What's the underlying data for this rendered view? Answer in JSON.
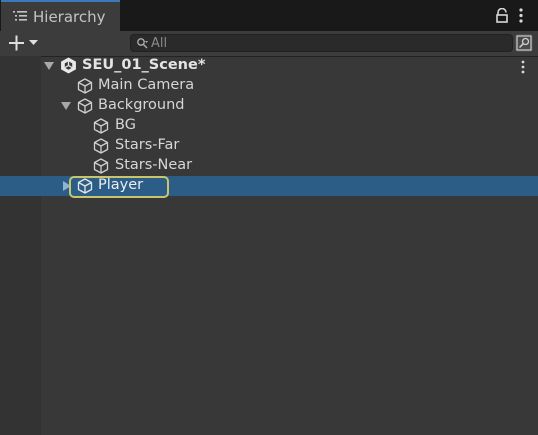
{
  "window": {
    "tab_title": "Hierarchy",
    "tab_icon": "list-icon"
  },
  "toolbar": {
    "add_label": "+",
    "search_placeholder": "All",
    "search_value": ""
  },
  "tree": {
    "scene": {
      "label": "SEU_01_Scene*",
      "expanded": true,
      "icon": "unity-logo-icon"
    },
    "items": [
      {
        "label": "Main Camera",
        "depth": 1,
        "expandable": false,
        "icon": "gameobject-cube-icon"
      },
      {
        "label": "Background",
        "depth": 1,
        "expandable": true,
        "expanded": true,
        "icon": "gameobject-cube-icon"
      },
      {
        "label": "BG",
        "depth": 2,
        "expandable": false,
        "icon": "gameobject-cube-icon"
      },
      {
        "label": "Stars-Far",
        "depth": 2,
        "expandable": false,
        "icon": "gameobject-cube-icon"
      },
      {
        "label": "Stars-Near",
        "depth": 2,
        "expandable": false,
        "icon": "gameobject-cube-icon"
      },
      {
        "label": "Player",
        "depth": 1,
        "expandable": true,
        "expanded": false,
        "selected": true,
        "renaming": true,
        "icon": "gameobject-cube-icon"
      }
    ]
  },
  "colors": {
    "selection": "#2c5d87",
    "rename_outline": "#c9c56d",
    "tab_accent": "#3a79bb"
  }
}
